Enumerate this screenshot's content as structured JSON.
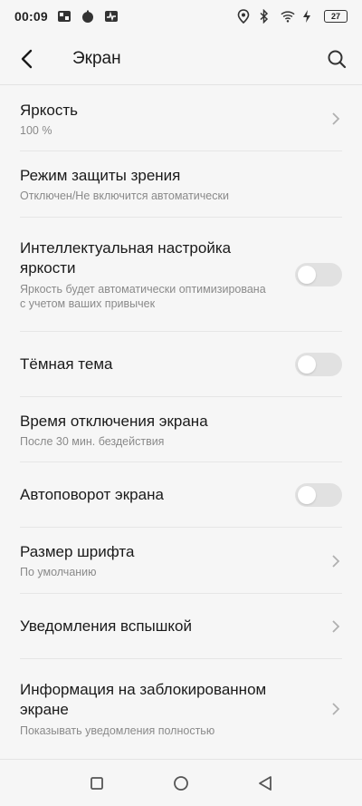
{
  "status_bar": {
    "time": "00:09",
    "battery": "27"
  },
  "header": {
    "title": "Экран"
  },
  "settings": [
    {
      "title": "Яркость",
      "subtitle": "100 %",
      "control": "chevron"
    },
    {
      "title": "Режим защиты зрения",
      "subtitle": "Отключен/Не включится автоматически",
      "control": "none"
    },
    {
      "title": "Интеллектуальная настройка яркости",
      "subtitle": "Яркость будет автоматически оптимизирована с учетом ваших привычек",
      "control": "toggle",
      "enabled": false
    },
    {
      "title": "Тёмная тема",
      "control": "toggle",
      "enabled": false
    },
    {
      "title": "Время отключения экрана",
      "subtitle": "После 30 мин. бездействия",
      "control": "none"
    },
    {
      "title": "Автоповорот экрана",
      "control": "toggle",
      "enabled": false
    },
    {
      "title": "Размер шрифта",
      "subtitle": "По умолчанию",
      "control": "chevron"
    },
    {
      "title": "Уведомления вспышкой",
      "control": "chevron"
    },
    {
      "title": "Информация на заблокированном экране",
      "subtitle": "Показывать уведомления полностью",
      "control": "chevron"
    }
  ],
  "icons": {
    "back": "back-arrow-icon",
    "search": "search-icon",
    "chevron": "chevron-right-icon",
    "nav_recent": "square-icon",
    "nav_home": "circle-icon",
    "nav_back": "triangle-back-icon"
  },
  "colors": {
    "background": "#f6f6f6",
    "text_primary": "#1a1a1a",
    "text_secondary": "#8a8a8a",
    "toggle_off": "#e1e1e1"
  }
}
